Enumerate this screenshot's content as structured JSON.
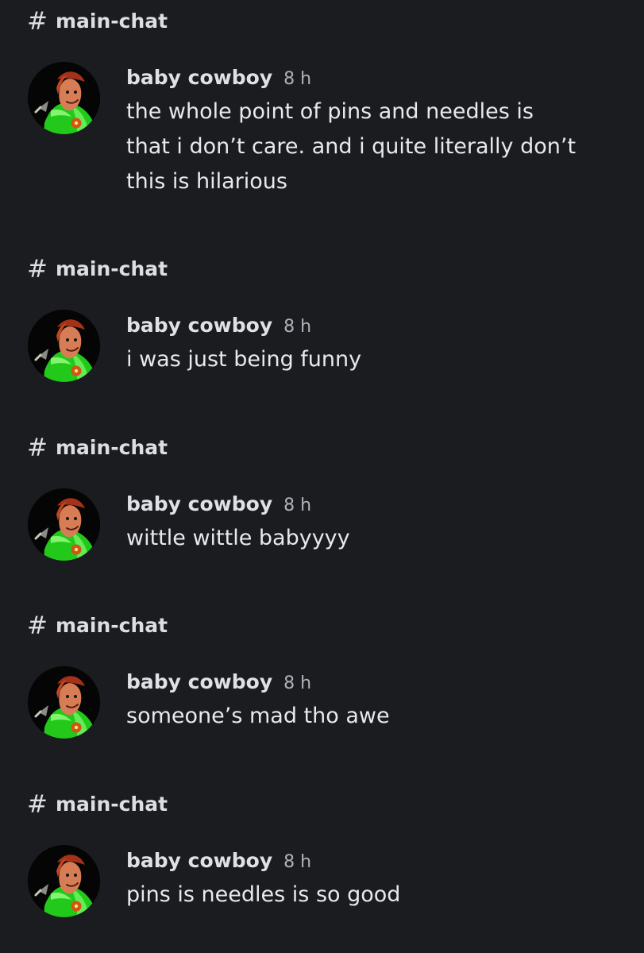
{
  "messages": [
    {
      "channel": "main-chat",
      "author": "baby cowboy",
      "time": "8 h",
      "lines": [
        "the whole point of pins and needles is",
        "that i don’t care. and i quite literally don’t",
        "this is hilarious"
      ]
    },
    {
      "channel": "main-chat",
      "author": "baby cowboy",
      "time": "8 h",
      "lines": [
        "i was just being funny"
      ]
    },
    {
      "channel": "main-chat",
      "author": "baby cowboy",
      "time": "8 h",
      "lines": [
        "wittle wittle babyyyy"
      ]
    },
    {
      "channel": "main-chat",
      "author": "baby cowboy",
      "time": "8 h",
      "lines": [
        "someone’s mad tho awe"
      ]
    },
    {
      "channel": "main-chat",
      "author": "baby cowboy",
      "time": "8 h",
      "lines": [
        "pins is needles is so good"
      ]
    }
  ],
  "icons": {
    "channel": "hash-icon",
    "avatar": "avatar"
  },
  "colors": {
    "background": "#1b1c20",
    "text": "#e8e9ee",
    "timestamp": "#aeb2ba",
    "avatar_green": "#24d61a"
  }
}
